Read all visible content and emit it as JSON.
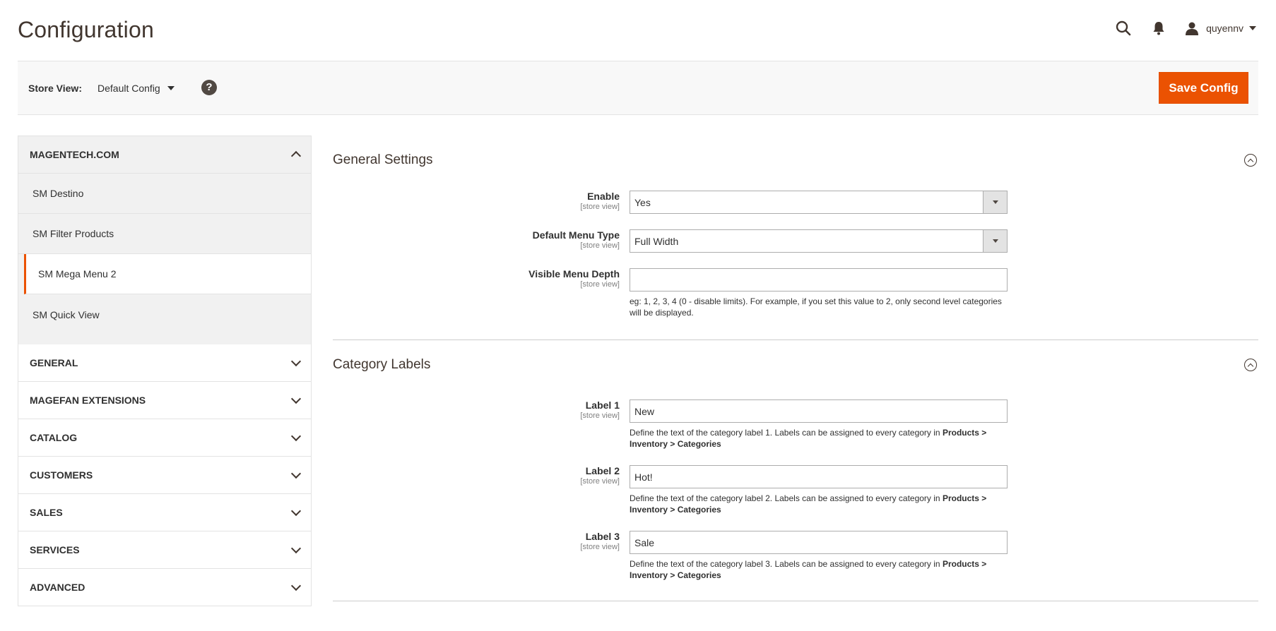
{
  "header": {
    "title": "Configuration",
    "user_name": "quyennv"
  },
  "store_bar": {
    "label": "Store View:",
    "selected": "Default Config",
    "save_label": "Save Config"
  },
  "colors": {
    "accent": "#eb5202",
    "text": "#303030",
    "panel": "#f1f1f1"
  },
  "sidebar": {
    "group": {
      "title": "MAGENTECH.COM",
      "items": [
        {
          "label": "SM Destino"
        },
        {
          "label": "SM Filter Products"
        },
        {
          "label": "SM Mega Menu 2"
        },
        {
          "label": "SM Quick View"
        }
      ],
      "active_index": 2
    },
    "sections": [
      {
        "label": "GENERAL"
      },
      {
        "label": "MAGEFAN EXTENSIONS"
      },
      {
        "label": "CATALOG"
      },
      {
        "label": "CUSTOMERS"
      },
      {
        "label": "SALES"
      },
      {
        "label": "SERVICES"
      },
      {
        "label": "ADVANCED"
      }
    ]
  },
  "general_settings": {
    "title": "General Settings",
    "enable": {
      "label": "Enable",
      "scope": "[store view]",
      "value": "Yes"
    },
    "menu_type": {
      "label": "Default Menu Type",
      "scope": "[store view]",
      "value": "Full Width"
    },
    "menu_depth": {
      "label": "Visible Menu Depth",
      "scope": "[store view]",
      "value": "",
      "note": "eg: 1, 2, 3, 4 (0 - disable limits). For example, if you set this value to 2, only second level categories will be displayed."
    }
  },
  "category_labels": {
    "title": "Category Labels",
    "note_link": "Products > Inventory > Categories",
    "labels": [
      {
        "label": "Label 1",
        "scope": "[store view]",
        "value": "New",
        "note": "Define the text of the category label 1. Labels can be assigned to every category in "
      },
      {
        "label": "Label 2",
        "scope": "[store view]",
        "value": "Hot!",
        "note": "Define the text of the category label 2. Labels can be assigned to every category in "
      },
      {
        "label": "Label 3",
        "scope": "[store view]",
        "value": "Sale",
        "note": "Define the text of the category label 3. Labels can be assigned to every category in "
      }
    ]
  }
}
